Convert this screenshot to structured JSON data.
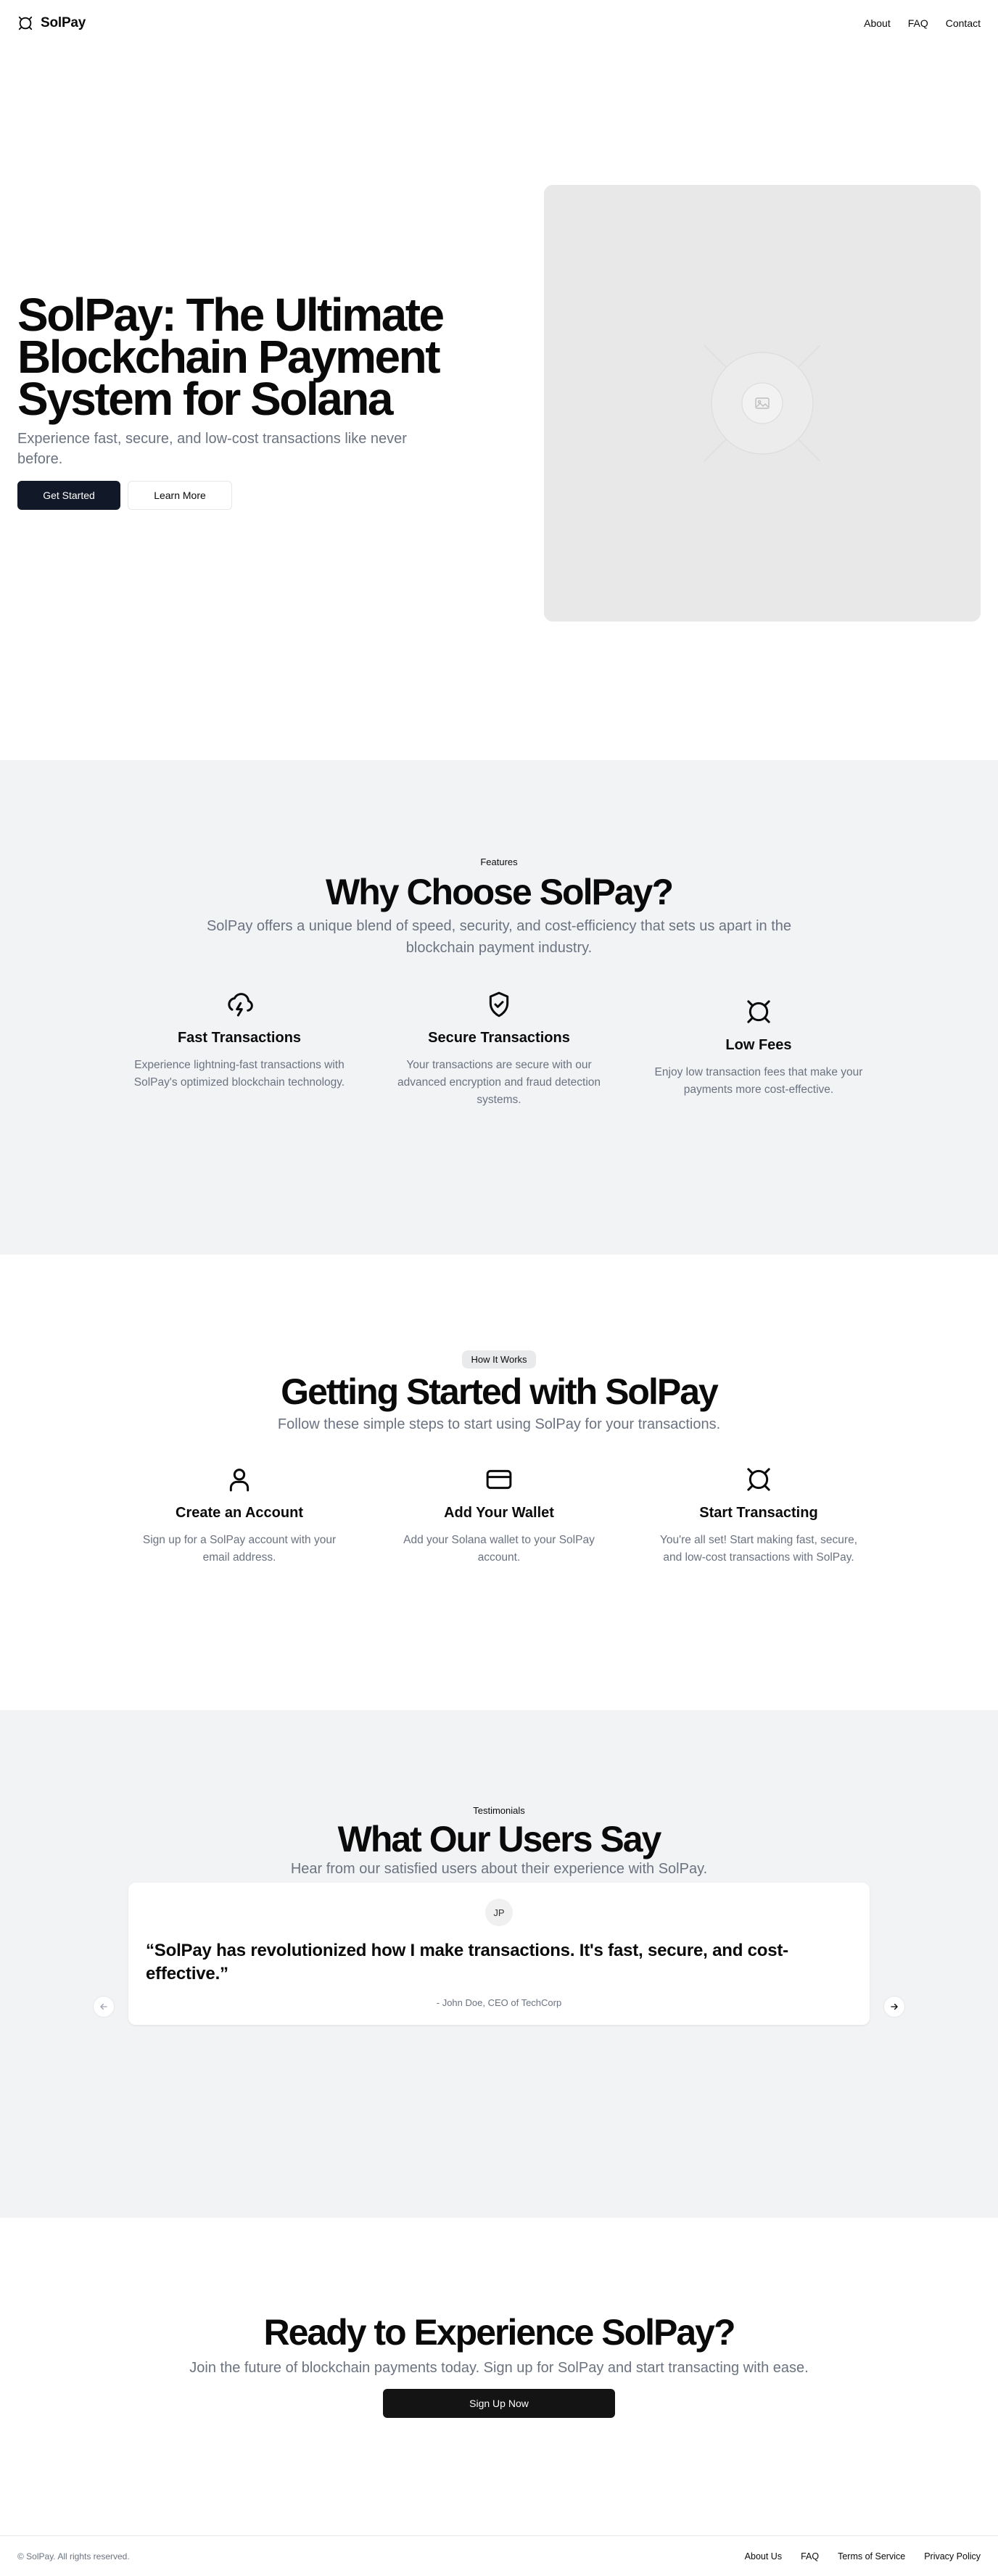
{
  "header": {
    "brand": "SolPay",
    "nav": [
      "About",
      "FAQ",
      "Contact"
    ]
  },
  "hero": {
    "title": "SolPay: The Ultimate Blockchain Payment System for Solana",
    "subtitle": "Experience fast, secure, and low-cost transactions like never before.",
    "primary_button": "Get Started",
    "secondary_button": "Learn More",
    "image_icon": "image-placeholder-icon"
  },
  "features": {
    "eyebrow": "Features",
    "title": "Why Choose SolPay?",
    "subtitle": "SolPay offers a unique blend of speed, security, and cost-efficiency that sets us apart in the blockchain payment industry.",
    "items": [
      {
        "icon": "cloud-lightning-icon",
        "title": "Fast Transactions",
        "text": "Experience lightning-fast transactions with SolPay's optimized blockchain technology."
      },
      {
        "icon": "shield-check-icon",
        "title": "Secure Transactions",
        "text": "Your transactions are secure with our advanced encryption and fraud detection systems."
      },
      {
        "icon": "currency-icon",
        "title": "Low Fees",
        "text": "Enjoy low transaction fees that make your payments more cost-effective."
      }
    ]
  },
  "steps": {
    "eyebrow": "How It Works",
    "title": "Getting Started with SolPay",
    "subtitle": "Follow these simple steps to start using SolPay for your transactions.",
    "items": [
      {
        "icon": "user-icon",
        "title": "Create an Account",
        "text": "Sign up for a SolPay account with your email address."
      },
      {
        "icon": "credit-card-icon",
        "title": "Add Your Wallet",
        "text": "Add your Solana wallet to your SolPay account."
      },
      {
        "icon": "currency-icon",
        "title": "Start Transacting",
        "text": "You're all set! Start making fast, secure, and low-cost transactions with SolPay."
      }
    ]
  },
  "testimonials": {
    "eyebrow": "Testimonials",
    "title": "What Our Users Say",
    "subtitle": "Hear from our satisfied users about their experience with SolPay.",
    "avatar": "JP",
    "quote": "“SolPay has revolutionized how I make transactions. It's fast, secure, and cost-effective.”",
    "author": "- John Doe, CEO of TechCorp"
  },
  "cta": {
    "title": "Ready to Experience SolPay?",
    "subtitle": "Join the future of blockchain payments today. Sign up for SolPay and start transacting with ease.",
    "button": "Sign Up Now"
  },
  "footer": {
    "copyright": "© SolPay. All rights reserved.",
    "links": [
      "About Us",
      "FAQ",
      "Terms of Service",
      "Privacy Policy"
    ]
  }
}
